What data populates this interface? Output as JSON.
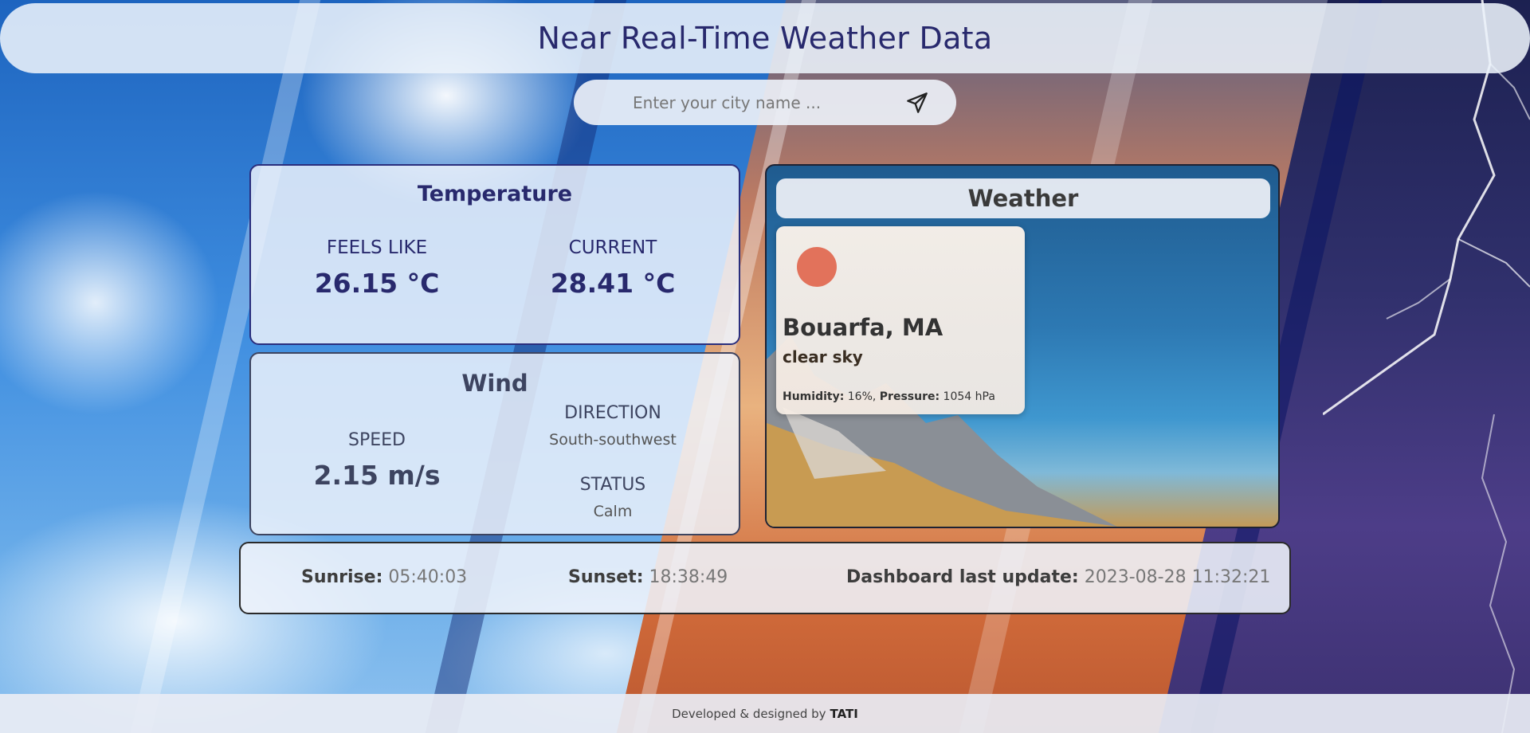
{
  "header": {
    "title": "Near Real-Time Weather Data"
  },
  "search": {
    "placeholder": "Enter your city name ...",
    "value": ""
  },
  "temperature": {
    "title": "Temperature",
    "feels_like_label": "FEELS LIKE",
    "feels_like_value": "26.15 °C",
    "current_label": "CURRENT",
    "current_value": "28.41 °C"
  },
  "wind": {
    "title": "Wind",
    "speed_label": "SPEED",
    "speed_value": "2.15 m/s",
    "direction_label": "DIRECTION",
    "direction_value": "South-southwest",
    "status_label": "STATUS",
    "status_value": "Calm"
  },
  "weather": {
    "title": "Weather",
    "city": "Bouarfa, MA",
    "description": "clear sky",
    "humidity_label": "Humidity:",
    "humidity_value": "16%,",
    "pressure_label": "Pressure:",
    "pressure_value": "1054 hPa",
    "icon_color": "#e2725b"
  },
  "sun": {
    "sunrise_label": "Sunrise:",
    "sunrise_value": "05:40:03",
    "sunset_label": "Sunset:",
    "sunset_value": "18:38:49",
    "update_label": "Dashboard last update:",
    "update_value": "2023-08-28 11:32:21"
  },
  "footer": {
    "text": "Developed & designed by",
    "author": "TATI"
  },
  "icons": {
    "send": "send-icon",
    "weather": "sun-icon"
  },
  "colors": {
    "accent": "#28296d",
    "sun": "#e2725b"
  }
}
